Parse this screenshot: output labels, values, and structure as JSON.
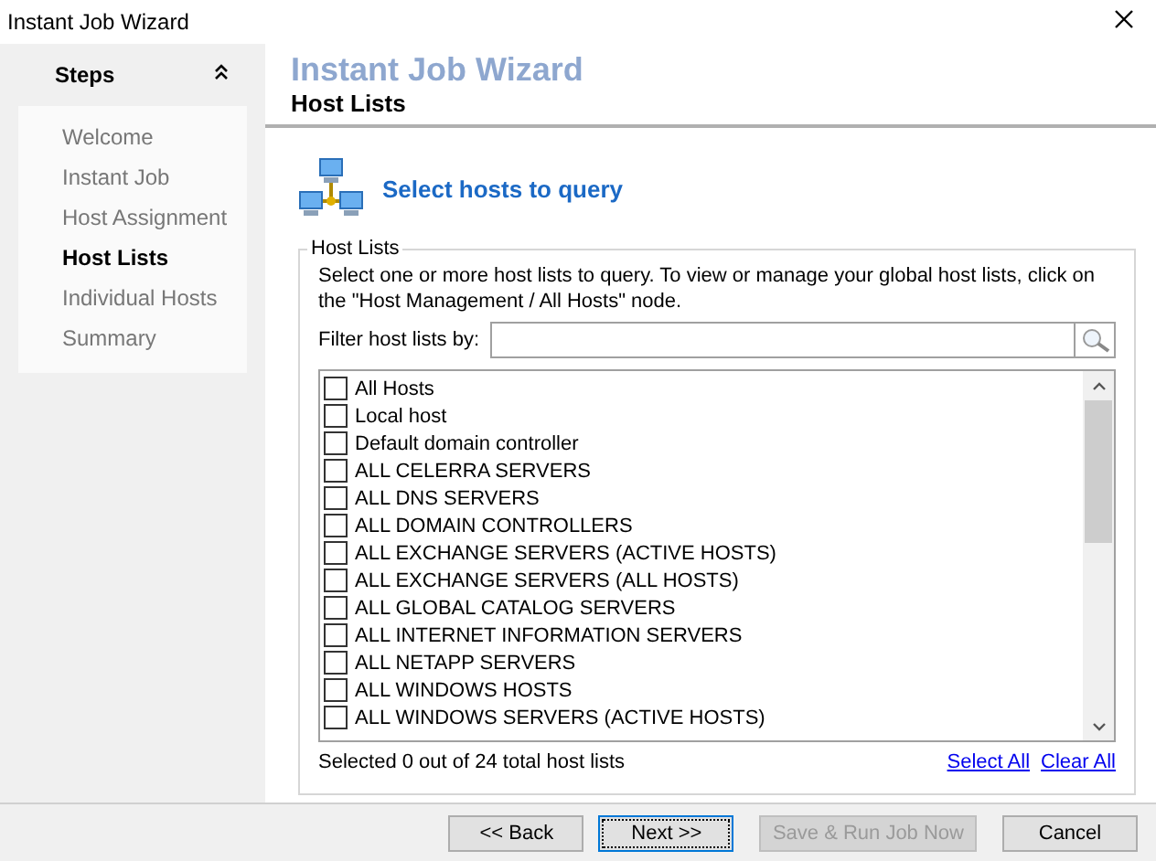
{
  "window": {
    "title": "Instant Job Wizard"
  },
  "steps": {
    "title": "Steps",
    "expanded": true,
    "items": [
      {
        "label": "Welcome",
        "selected": false
      },
      {
        "label": "Instant Job",
        "selected": false
      },
      {
        "label": "Host Assignment",
        "selected": false
      },
      {
        "label": "Host Lists",
        "selected": true
      },
      {
        "label": "Individual Hosts",
        "selected": false
      },
      {
        "label": "Summary",
        "selected": false
      }
    ]
  },
  "header": {
    "title": "Instant Job Wizard",
    "subtitle": "Host Lists"
  },
  "section_heading": "Select hosts to query",
  "group": {
    "title": "Host Lists",
    "description": "Select one or more host lists to query.  To view or manage your global host lists, click on the \"Host Management / All Hosts\" node.",
    "filter": {
      "label": "Filter host lists by:"
    },
    "items": [
      {
        "label": "All Hosts",
        "checked": false
      },
      {
        "label": "Local host",
        "checked": false
      },
      {
        "label": "Default domain controller",
        "checked": false
      },
      {
        "label": "ALL CELERRA SERVERS",
        "checked": false
      },
      {
        "label": "ALL DNS SERVERS",
        "checked": false
      },
      {
        "label": "ALL DOMAIN CONTROLLERS",
        "checked": false
      },
      {
        "label": "ALL EXCHANGE SERVERS (ACTIVE HOSTS)",
        "checked": false
      },
      {
        "label": "ALL EXCHANGE SERVERS (ALL HOSTS)",
        "checked": false
      },
      {
        "label": "ALL GLOBAL CATALOG SERVERS",
        "checked": false
      },
      {
        "label": "ALL INTERNET INFORMATION SERVERS",
        "checked": false
      },
      {
        "label": "ALL NETAPP SERVERS",
        "checked": false
      },
      {
        "label": "ALL WINDOWS HOSTS",
        "checked": false
      },
      {
        "label": "ALL WINDOWS SERVERS (ACTIVE HOSTS)",
        "checked": false
      }
    ],
    "status": "Selected 0 out of 24 total host lists",
    "links": [
      "Select All",
      "Clear All"
    ]
  },
  "buttons": [
    {
      "label": "<< Back",
      "disabled": false,
      "focused": false
    },
    {
      "label": "Next >>",
      "disabled": false,
      "focused": true
    },
    {
      "label": "Save & Run Job Now",
      "disabled": true,
      "focused": false
    },
    {
      "label": "Cancel",
      "disabled": false,
      "focused": false
    }
  ]
}
